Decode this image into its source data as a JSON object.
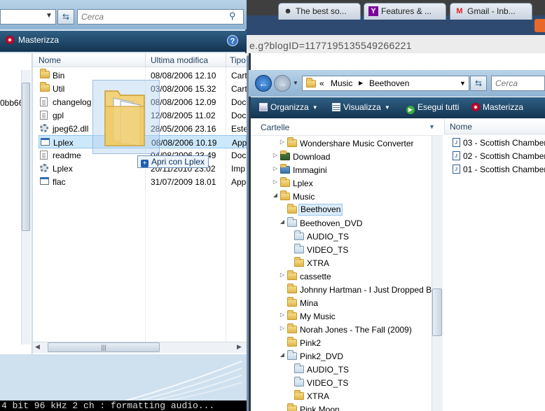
{
  "browser": {
    "tabs": [
      {
        "label": "The best so...",
        "icon": "ghost-icon"
      },
      {
        "label": "Features & ...",
        "icon": "yahoo-icon",
        "mark": "Y"
      },
      {
        "label": "Gmail - Inb...",
        "icon": "gmail-icon",
        "mark": "M"
      }
    ],
    "url": "e.g?blogID=1177195135549266221"
  },
  "left_window": {
    "search_placeholder": "Cerca",
    "toolbar_label": "Masterizza",
    "help_label": "?",
    "nav_partial_text": "0bb66",
    "columns": {
      "name": "Nome",
      "date": "Ultima modifica",
      "type": "Tipo"
    },
    "files": [
      {
        "name": "Bin",
        "date": "08/08/2006 12.10",
        "type": "Cart",
        "icon": "folder-icon"
      },
      {
        "name": "Util",
        "date": "03/08/2006 15.32",
        "type": "Cart",
        "icon": "folder-icon"
      },
      {
        "name": "changelog",
        "date": "08/08/2006 12.09",
        "type": "Doc",
        "icon": "document-icon"
      },
      {
        "name": "gpl",
        "date": "12/08/2005 11.02",
        "type": "Doc",
        "icon": "document-icon"
      },
      {
        "name": "jpeg62.dll",
        "date": "28/05/2006 23.16",
        "type": "Este",
        "icon": "gear-icon"
      },
      {
        "name": "Lplex",
        "date": "08/08/2006 10.19",
        "type": "App",
        "icon": "application-icon",
        "selected": true
      },
      {
        "name": "readme",
        "date": "04/08/2006 23.49",
        "type": "Doc",
        "icon": "document-icon"
      },
      {
        "name": "Lplex",
        "date": "20/11/2010 23.02",
        "type": "Imp",
        "icon": "settings-file-icon"
      },
      {
        "name": "flac",
        "date": "31/07/2009 18.01",
        "type": "App",
        "icon": "application-icon"
      }
    ],
    "drop_tooltip": "Apri con Lplex",
    "console_text": "4 bit 96 kHz 2 ch : formatting audio..."
  },
  "right_window": {
    "breadcrumb": [
      "«",
      "Music",
      "Beethoven"
    ],
    "search_placeholder": "Cerca",
    "toolbar": {
      "organize": "Organizza",
      "view": "Visualizza",
      "play_all": "Esegui tutti",
      "burn": "Masterizza"
    },
    "tree_header": "Cartelle",
    "tree": [
      {
        "label": "Wondershare Music Converter",
        "level": 1,
        "toggle": "▷",
        "kind": "folder"
      },
      {
        "label": "Download",
        "level": 0,
        "toggle": "▷",
        "kind": "folder"
      },
      {
        "label": "Immagini",
        "level": 0,
        "toggle": "▷",
        "kind": "folder"
      },
      {
        "label": "Lplex",
        "level": 0,
        "toggle": "▷",
        "kind": "folder"
      },
      {
        "label": "Music",
        "level": 0,
        "toggle": "◢",
        "kind": "folder"
      },
      {
        "label": "Beethoven",
        "level": 1,
        "toggle": "",
        "kind": "folder",
        "selected": true
      },
      {
        "label": "Beethoven_DVD",
        "level": 1,
        "toggle": "◢",
        "kind": "media"
      },
      {
        "label": "AUDIO_TS",
        "level": 2,
        "toggle": "",
        "kind": "media"
      },
      {
        "label": "VIDEO_TS",
        "level": 2,
        "toggle": "",
        "kind": "media"
      },
      {
        "label": "XTRA",
        "level": 2,
        "toggle": "",
        "kind": "folder"
      },
      {
        "label": "cassette",
        "level": 1,
        "toggle": "▷",
        "kind": "folder"
      },
      {
        "label": "Johnny Hartman - I Just Dropped B",
        "level": 1,
        "toggle": "",
        "kind": "folder"
      },
      {
        "label": "Mina",
        "level": 1,
        "toggle": "",
        "kind": "folder"
      },
      {
        "label": "My Music",
        "level": 1,
        "toggle": "▷",
        "kind": "folder"
      },
      {
        "label": "Norah Jones - The Fall (2009)",
        "level": 1,
        "toggle": "▷",
        "kind": "folder"
      },
      {
        "label": "Pink2",
        "level": 1,
        "toggle": "",
        "kind": "folder"
      },
      {
        "label": "Pink2_DVD",
        "level": 1,
        "toggle": "◢",
        "kind": "media"
      },
      {
        "label": "AUDIO_TS",
        "level": 2,
        "toggle": "",
        "kind": "media"
      },
      {
        "label": "VIDEO_TS",
        "level": 2,
        "toggle": "",
        "kind": "media"
      },
      {
        "label": "XTRA",
        "level": 2,
        "toggle": "",
        "kind": "folder"
      },
      {
        "label": "Pink Moon",
        "level": 1,
        "toggle": "",
        "kind": "folder"
      }
    ],
    "list_header": "Nome",
    "files": [
      {
        "label": "03 - Scottish Chamber"
      },
      {
        "label": "02 - Scottish Chamber"
      },
      {
        "label": "01 - Scottish Chamber"
      }
    ]
  },
  "colors": {
    "toolbar": "#1f4666",
    "selection": "#cde8fb",
    "browser_accent": "#e8672a"
  }
}
